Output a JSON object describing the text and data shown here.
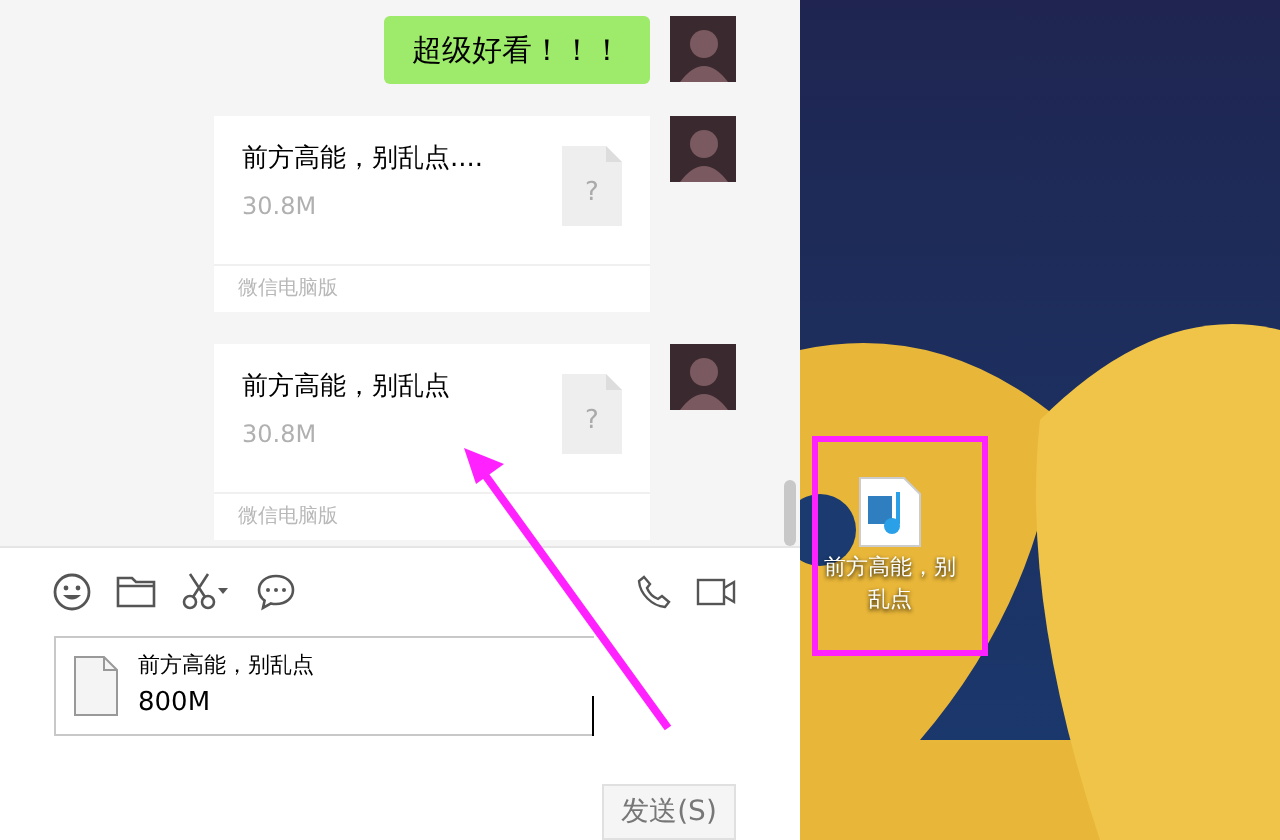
{
  "chat": {
    "messages": [
      {
        "kind": "text",
        "text": "超级好看！！！"
      },
      {
        "kind": "file",
        "name": "前方高能，别乱点....",
        "size": "30.8M",
        "icon_glyph": "?",
        "source": "微信电脑版"
      },
      {
        "kind": "file",
        "name": "前方高能，别乱点",
        "size": "30.8M",
        "icon_glyph": "?",
        "source": "微信电脑版"
      }
    ]
  },
  "input": {
    "attachment": {
      "name": "前方高能，别乱点",
      "size": "800M"
    }
  },
  "send_button": "发送(S)",
  "desktop": {
    "icon_label": "前方高能，别乱点"
  }
}
